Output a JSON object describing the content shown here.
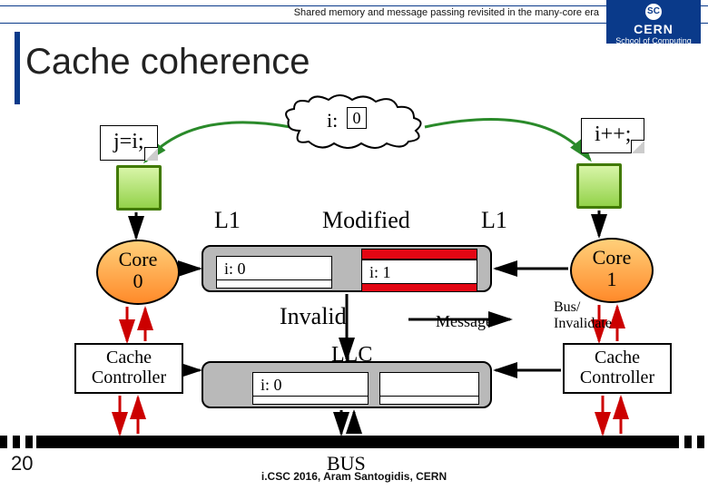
{
  "header": {
    "topic": "Shared memory and message passing revisited in the many-core era",
    "logo": {
      "org": "CERN",
      "line": "School of Computing"
    }
  },
  "title": "Cache coherence",
  "page_number": "20",
  "footer": "i.CSC 2016, Aram Santogidis, CERN",
  "diagram": {
    "shared_var": {
      "label": "i:",
      "value": "0"
    },
    "note_left": "j=i;",
    "note_right": "i++;",
    "l1_left": "L1",
    "l1_right": "L1",
    "state_modified": "Modified",
    "core0": {
      "line1": "Core",
      "line2": "0"
    },
    "core1": {
      "line1": "Core",
      "line2": "1"
    },
    "cache_left_cell": "i: 0",
    "cache_right_cell": "i: 1",
    "state_invalid": "Invalid",
    "message_label": "Message",
    "bus_invalidate": {
      "l1": "Bus/",
      "l2": "Invalidate"
    },
    "llc_label": "LLC",
    "llc_cell": "i: 0",
    "cache_ctrl_left": {
      "l1": "Cache",
      "l2": "Controller"
    },
    "cache_ctrl_right": {
      "l1": "Cache",
      "l2": "Controller"
    },
    "bus_label": "BUS"
  }
}
